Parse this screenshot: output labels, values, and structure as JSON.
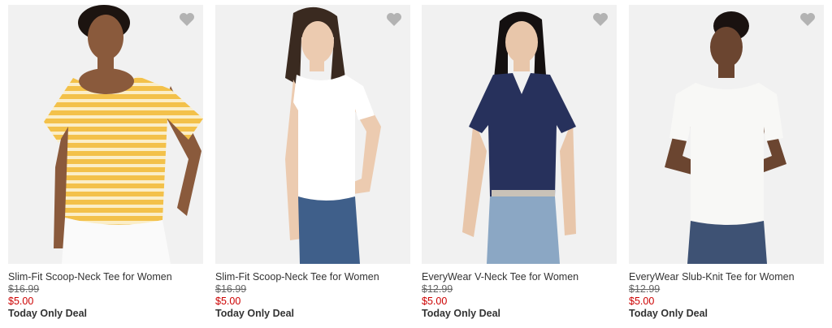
{
  "products": [
    {
      "name": "Slim-Fit Scoop-Neck Tee for Women",
      "original_price": "$16.99",
      "sale_price": "$5.00",
      "deal_label": "Today Only Deal",
      "shirt_color": "yellow-white stripes",
      "favorite_icon": "heart-icon"
    },
    {
      "name": "Slim-Fit Scoop-Neck Tee for Women",
      "original_price": "$16.99",
      "sale_price": "$5.00",
      "deal_label": "Today Only Deal",
      "shirt_color": "white",
      "favorite_icon": "heart-icon"
    },
    {
      "name": "EveryWear V-Neck Tee for Women",
      "original_price": "$12.99",
      "sale_price": "$5.00",
      "deal_label": "Today Only Deal",
      "shirt_color": "navy",
      "favorite_icon": "heart-icon"
    },
    {
      "name": "EveryWear Slub-Knit Tee for Women",
      "original_price": "$12.99",
      "sale_price": "$5.00",
      "deal_label": "Today Only Deal",
      "shirt_color": "white",
      "favorite_icon": "heart-icon"
    }
  ],
  "colors": {
    "sale_price": "#cc0000",
    "heart": "#b3b3b3",
    "photo_bg": "#f1f1f1"
  }
}
